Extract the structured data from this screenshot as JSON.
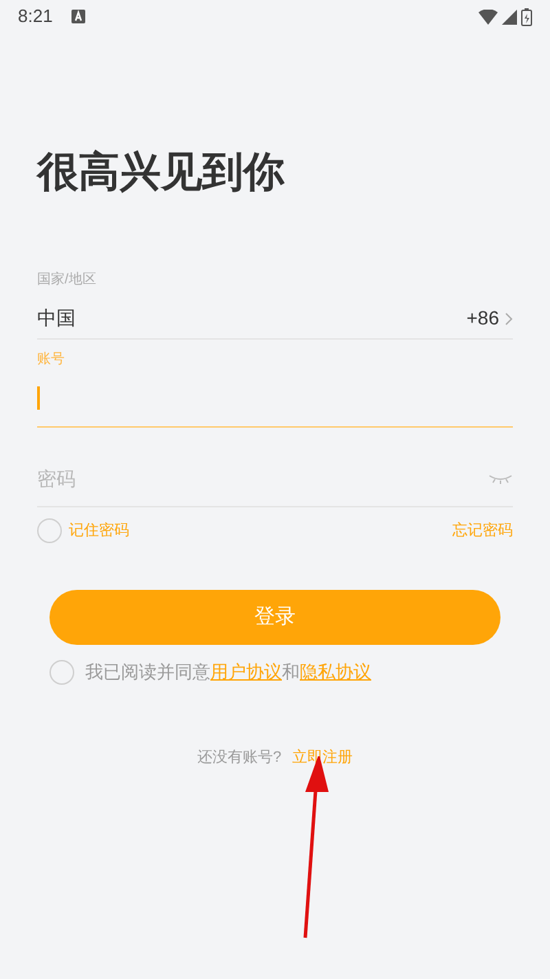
{
  "status_bar": {
    "time": "8:21"
  },
  "heading": "很高兴见到你",
  "region": {
    "label": "国家/地区",
    "value": "中国",
    "code": "+86"
  },
  "account": {
    "label": "账号",
    "focused": true
  },
  "password": {
    "placeholder": "密码"
  },
  "remember": {
    "label": "记住密码",
    "checked": false
  },
  "forgot": "忘记密码",
  "login_button": "登录",
  "agreement": {
    "checked": false,
    "text": "我已阅读并同意",
    "link1": "用户协议",
    "joiner": "和",
    "link2": "隐私协议"
  },
  "register": {
    "prompt": "还没有账号?",
    "link": "立即注册"
  }
}
